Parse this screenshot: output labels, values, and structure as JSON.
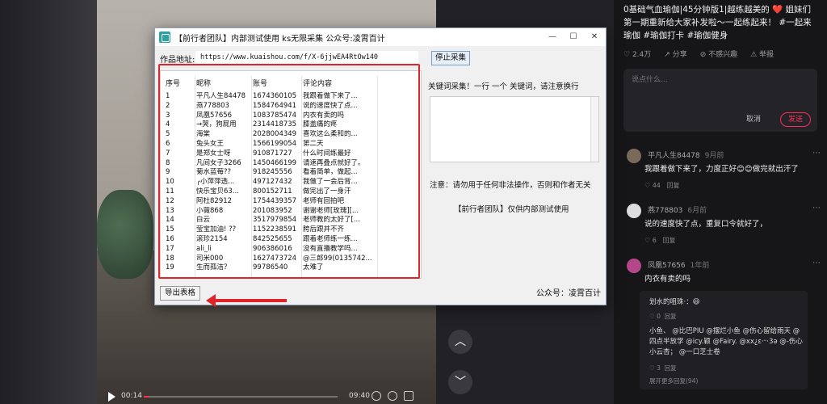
{
  "video": {
    "time_current": "00:14",
    "time_total": "09:40",
    "progress_fraction": 0.024
  },
  "side": {
    "title": "0基础气血瑜伽|45分钟版1|越练越美的 ❤️ 姐妹们第一期重新给大家补发啦～一起练起来！ #一起来瑜伽 #瑜伽打卡 #瑜伽健身",
    "likes": "2.4万",
    "share": "分享",
    "not_interested": "不感兴趣",
    "report": "举报",
    "comment_placeholder": "说点什么...",
    "cancel": "取消",
    "send": "发送",
    "comments": [
      {
        "name": "平凡人生84478",
        "time": "9月前",
        "body": "我跟着做下来了，力度正好😊😊做完就出汗了",
        "likes": "44",
        "reply": "回复"
      },
      {
        "name": "燕778803",
        "time": "6月前",
        "body": "说的速度快了点，重复口令就好了，",
        "likes": "6",
        "reply": "回复"
      },
      {
        "name": "凤凰57656",
        "time": "1年前",
        "body": "内衣有卖的吗",
        "likes": "",
        "reply": ""
      }
    ],
    "sub_replies": [
      {
        "body": "划水的咀珠·：😆",
        "likes": "0",
        "reply": "回复"
      },
      {
        "body": "小鱼、 @比巴PIU @摆烂小鱼 @伤心留给雨天 @四点半放学 @icy.颖 @Fairy. @xx¿ɛ·ᵕ·3ə @-伤心小云杏； @一口芝士卷",
        "likes": "3",
        "reply": "回复"
      }
    ],
    "expand": "展开更多回复(94)"
  },
  "tool": {
    "title": "【前行者团队】内部测试使用 ks无限采集 公众号:凌霄百计",
    "url_label": "作品地址:",
    "url_value": "https://www.kuaishou.com/f/X-6jjwEA4RtOw140",
    "stop_button": "停止采集",
    "headers": [
      "序号",
      "昵称",
      "账号",
      "评论内容"
    ],
    "rows": [
      [
        "1",
        "平凡人生84478",
        "1674360105",
        "我跟着做下来了..."
      ],
      [
        "2",
        "燕778803",
        "1584764941",
        "说的速度快了点..."
      ],
      [
        "3",
        "凤凰57656",
        "1083785474",
        "内衣有卖的吗"
      ],
      [
        "4",
        "→哭，狗屁用",
        "2314418735",
        "膝盖痛的疼"
      ],
      [
        "5",
        "海棠",
        "2028004349",
        "喜欢这么柔和的..."
      ],
      [
        "6",
        "兔头女王",
        "1566199054",
        "第二天"
      ],
      [
        "7",
        "是郑女士呀",
        "910871727",
        "什么时间练最好"
      ],
      [
        "8",
        "凡间女子3266",
        "1450466199",
        "请速再叠点就好了。"
      ],
      [
        "9",
        "菊水蓝莓??",
        "918245556",
        "看着简单，做起..."
      ],
      [
        "10",
        "╭小萍萍透...",
        "497127432",
        "我做了一会后背..."
      ],
      [
        "11",
        "快乐宝贝63...",
        "800152711",
        "做完出了一身汗"
      ],
      [
        "12",
        "阿杜82912",
        "1754439357",
        "老师有回拍吧"
      ],
      [
        "13",
        "小薇868",
        "201083952",
        "谢谢老师[玫瑰][..."
      ],
      [
        "14",
        "白云",
        "3517979854",
        "老师教的太好了[..."
      ],
      [
        "15",
        "莹宝加油! ??",
        "1152238591",
        "胯后跟并不齐"
      ],
      [
        "16",
        "滚珍2154",
        "842525655",
        "跟着老师练一练..."
      ],
      [
        "17",
        "ali_li",
        "906386016",
        "没有直播教学吗..."
      ],
      [
        "18",
        "司米000",
        "1627473724",
        "@三郎99(0135742..."
      ],
      [
        "19",
        "生而孤洁？",
        "99786540",
        "太难了"
      ]
    ],
    "keyword_label": "关键词采集！一行 一个 关键词，请注意换行",
    "keyword_value": "",
    "notice": "注意：请勿用于任何非法操作，否则和作者无关",
    "team_notice": "【前行者团队】仅供内部测试使用",
    "export_button": "导出表格",
    "footer": "公众号：凌霄百计",
    "window_controls": [
      "—",
      "☐",
      "✕"
    ]
  },
  "colors": {
    "accent": "#fe2c55",
    "highlight": "#e0242a"
  }
}
